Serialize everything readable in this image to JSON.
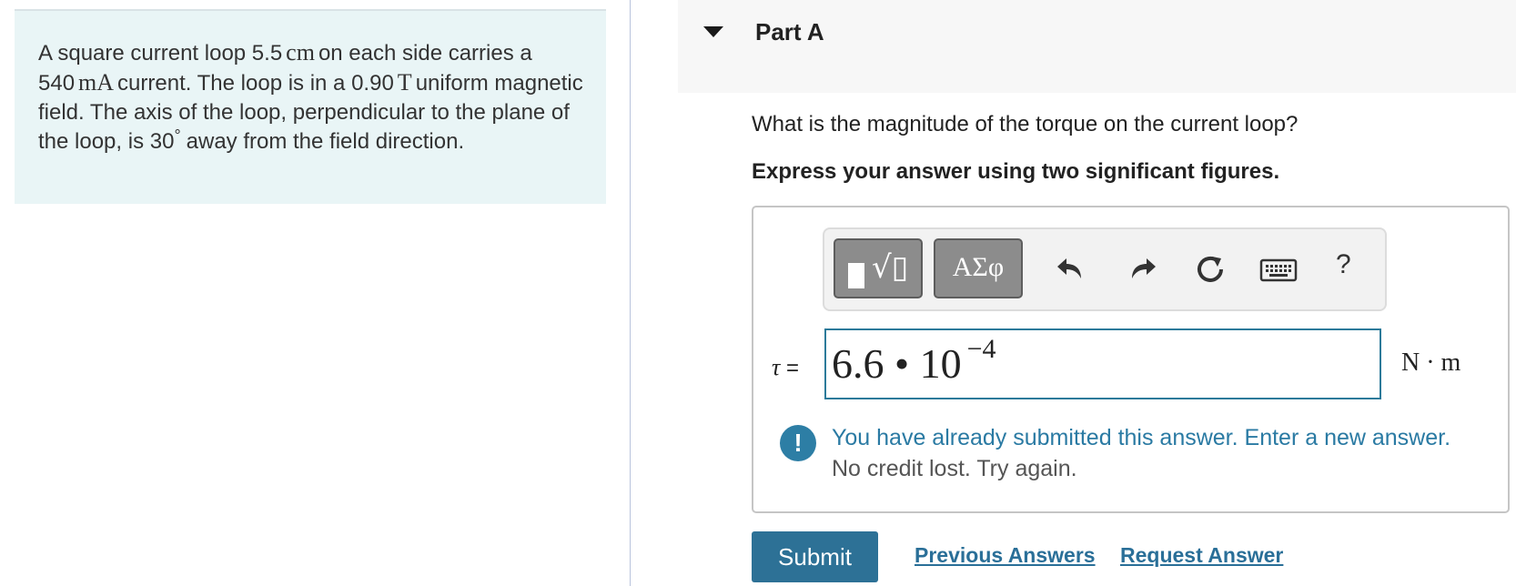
{
  "problem": {
    "p1": "A square current loop 5.5",
    "u1": "cm",
    "p2": "on each side carries a 540",
    "u2": "mA",
    "p3": "current. The loop is in a 0.90",
    "u3": "T",
    "p4": "uniform magnetic field. The axis of the loop, perpendicular to the plane of the loop, is 30",
    "deg": "°",
    "p5": "away from the field direction."
  },
  "part": {
    "title": "Part A"
  },
  "question": "What is the magnitude of the torque on the current loop?",
  "instruction": "Express your answer using two significant figures.",
  "toolbar": {
    "templates_icon": "templates-sqrt-icon",
    "greek_label": "ΑΣφ",
    "undo_icon": "undo-icon",
    "redo_icon": "redo-icon",
    "reset_icon": "reset-icon",
    "keyboard_icon": "keyboard-icon",
    "help_label": "?"
  },
  "answer": {
    "variable": "τ",
    "equals": "=",
    "mantissa": "6.6 • 10",
    "exponent": "−4",
    "unit": "N · m"
  },
  "feedback": {
    "icon": "!",
    "message": "You have already submitted this answer. Enter a new answer.",
    "note": "No credit lost. Try again."
  },
  "actions": {
    "submit_label": "Submit",
    "previous_answers_label": "Previous Answers",
    "request_answer_label": "Request Answer"
  },
  "colors": {
    "problem_bg": "#e9f5f6",
    "accent": "#2d7196",
    "feedback_text": "#2a7aa3",
    "input_border": "#2c7a9a"
  }
}
